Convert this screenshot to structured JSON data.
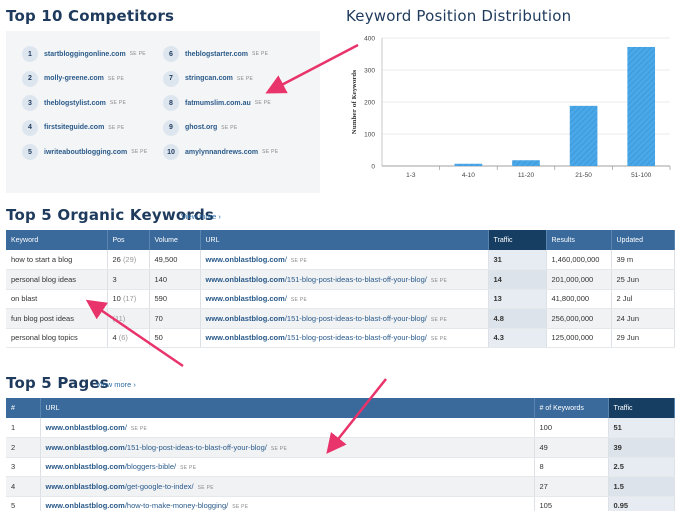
{
  "competitors": {
    "title": "Top 10 Competitors",
    "items": [
      {
        "num": "1",
        "domain": "startbloggingonline.com",
        "tag": "SE PE"
      },
      {
        "num": "2",
        "domain": "molly-greene.com",
        "tag": "SE PE"
      },
      {
        "num": "3",
        "domain": "theblogstylist.com",
        "tag": "SE PE"
      },
      {
        "num": "4",
        "domain": "firstsiteguide.com",
        "tag": "SE PE"
      },
      {
        "num": "5",
        "domain": "iwriteaboutblogging.com",
        "tag": "SE PE"
      },
      {
        "num": "6",
        "domain": "theblogstarter.com",
        "tag": "SE PE"
      },
      {
        "num": "7",
        "domain": "stringcan.com",
        "tag": "SE PE"
      },
      {
        "num": "8",
        "domain": "fatmumslim.com.au",
        "tag": "SE PE"
      },
      {
        "num": "9",
        "domain": "ghost.org",
        "tag": "SE PE"
      },
      {
        "num": "10",
        "domain": "amylynnandrews.com",
        "tag": "SE PE"
      }
    ]
  },
  "distribution": {
    "title": "Keyword Position Distribution"
  },
  "chart_data": {
    "type": "bar",
    "title": "Keyword Position Distribution",
    "categories": [
      "1-3",
      "4-10",
      "11-20",
      "21-50",
      "51-100"
    ],
    "values": [
      0,
      7,
      18,
      188,
      372
    ],
    "xlabel": "",
    "ylabel": "Number of Keywords",
    "ylim": [
      0,
      400
    ],
    "yticks": [
      "0",
      "100",
      "200",
      "300",
      "400"
    ],
    "bar_color": "#4aa8e8",
    "grid": true
  },
  "keywords": {
    "title": "Top 5 Organic Keywords",
    "view_more": "View more ›",
    "columns": [
      "Keyword",
      "Pos",
      "Volume",
      "URL",
      "Traffic",
      "Results",
      "Updated"
    ],
    "rows": [
      {
        "keyword": "how to start a blog",
        "pos": "26",
        "prev": "(29)",
        "volume": "49,500",
        "url_domain": "www.onblastblog.com",
        "url_path": "/",
        "tag": "SE PE",
        "traffic": "31",
        "results": "1,460,000,000",
        "updated": "39 m"
      },
      {
        "keyword": "personal blog ideas",
        "pos": "3",
        "prev": "",
        "volume": "140",
        "url_domain": "www.onblastblog.com",
        "url_path": "/151-blog-post-ideas-to-blast-off-your-blog/",
        "tag": "SE PE",
        "traffic": "14",
        "results": "201,000,000",
        "updated": "25 Jun"
      },
      {
        "keyword": "on blast",
        "pos": "10",
        "prev": "(17)",
        "volume": "590",
        "url_domain": "www.onblastblog.com",
        "url_path": "/",
        "tag": "SE PE",
        "traffic": "13",
        "results": "41,800,000",
        "updated": "2 Jul"
      },
      {
        "keyword": "fun blog post ideas",
        "pos": "",
        "prev": "(11)",
        "volume": "70",
        "url_domain": "www.onblastblog.com",
        "url_path": "/151-blog-post-ideas-to-blast-off-your-blog/",
        "tag": "SE PE",
        "traffic": "4.8",
        "results": "256,000,000",
        "updated": "24 Jun"
      },
      {
        "keyword": "personal blog topics",
        "pos": "4",
        "prev": "(6)",
        "volume": "50",
        "url_domain": "www.onblastblog.com",
        "url_path": "/151-blog-post-ideas-to-blast-off-your-blog/",
        "tag": "SE PE",
        "traffic": "4.3",
        "results": "125,000,000",
        "updated": "29 Jun"
      }
    ]
  },
  "pages": {
    "title": "Top 5 Pages",
    "view_more": "View more ›",
    "columns": [
      "#",
      "URL",
      "# of Keywords",
      "Traffic"
    ],
    "rows": [
      {
        "num": "1",
        "url_domain": "www.onblastblog.com",
        "url_path": "/",
        "tag": "SE PE",
        "keywords": "100",
        "traffic": "51"
      },
      {
        "num": "2",
        "url_domain": "www.onblastblog.com",
        "url_path": "/151-blog-post-ideas-to-blast-off-your-blog/",
        "tag": "SE PE",
        "keywords": "49",
        "traffic": "39"
      },
      {
        "num": "3",
        "url_domain": "www.onblastblog.com",
        "url_path": "/bloggers-bible/",
        "tag": "SE PE",
        "keywords": "8",
        "traffic": "2.5"
      },
      {
        "num": "4",
        "url_domain": "www.onblastblog.com",
        "url_path": "/get-google-to-index/",
        "tag": "SE PE",
        "keywords": "27",
        "traffic": "1.5"
      },
      {
        "num": "5",
        "url_domain": "www.onblastblog.com",
        "url_path": "/how-to-make-money-blogging/",
        "tag": "SE PE",
        "keywords": "105",
        "traffic": "0.95"
      }
    ]
  },
  "colors": {
    "header_blue": "#3a6a9c",
    "header_active": "#163e63",
    "title_navy": "#1e3a5c",
    "link_blue": "#2a5a8a",
    "arrow_pink": "#e8336b"
  }
}
